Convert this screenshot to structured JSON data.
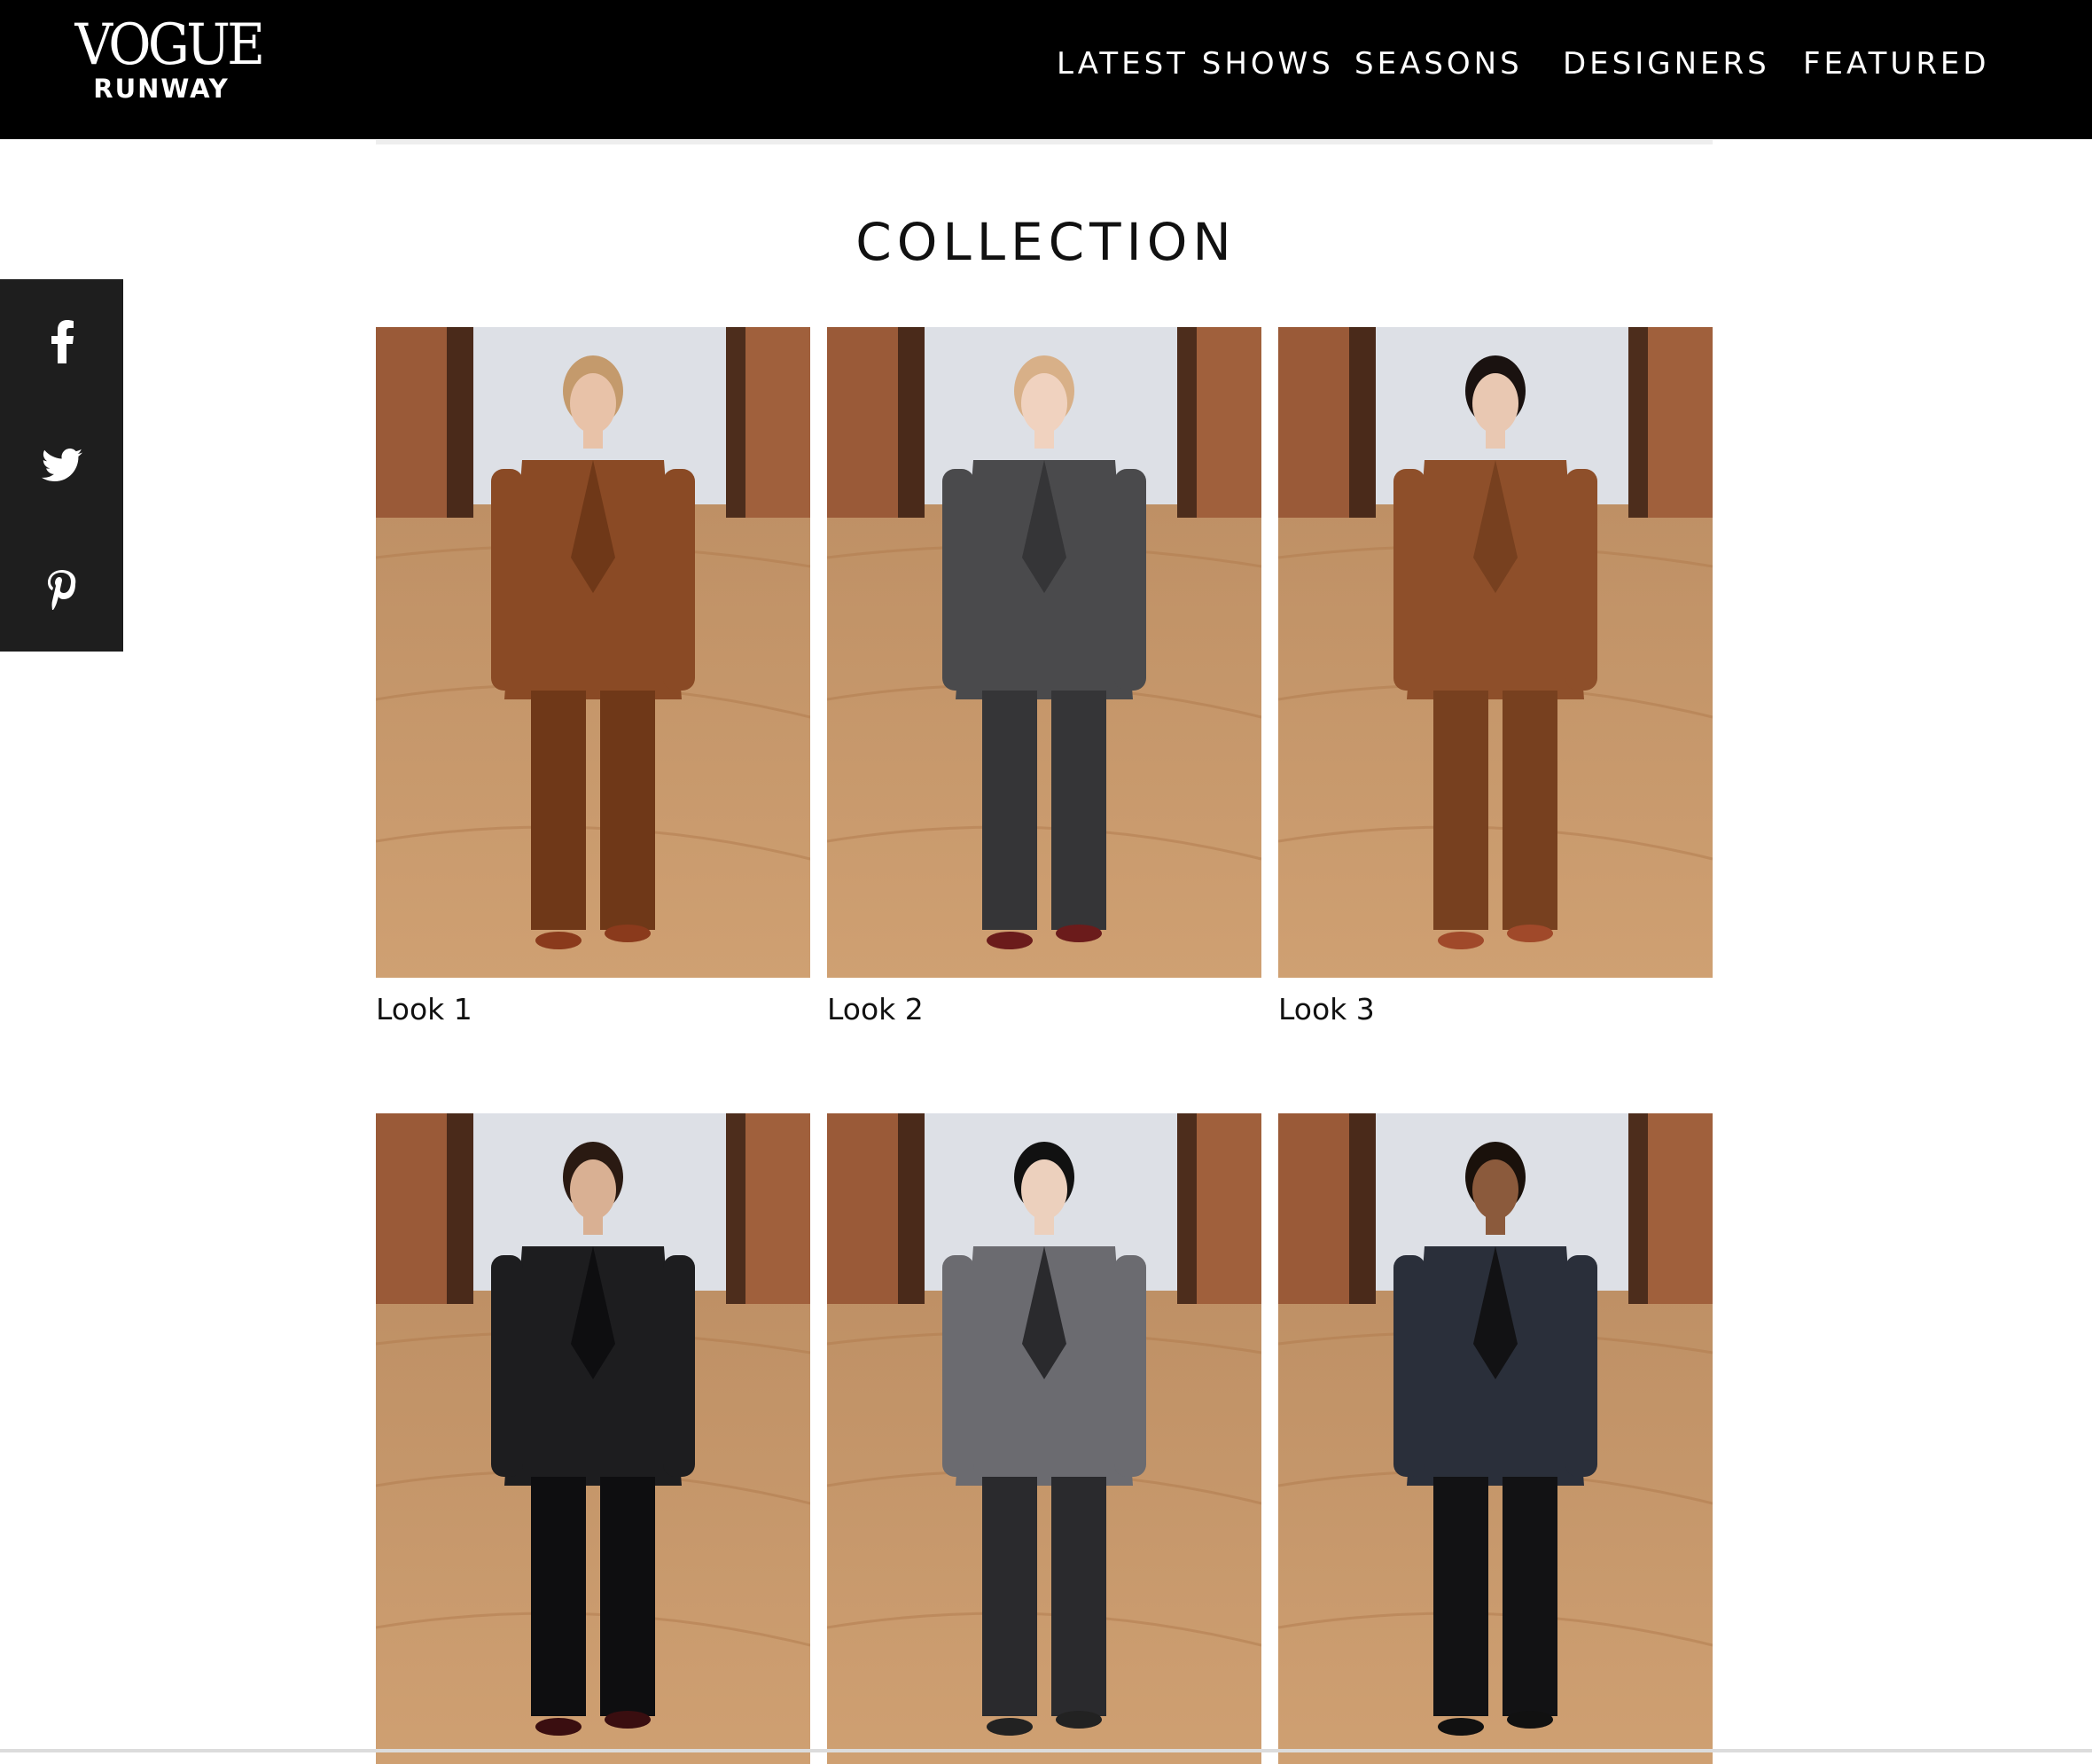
{
  "header": {
    "logo_main": "VOGUE",
    "logo_sub": "RUNWAY",
    "nav": [
      "LATEST SHOWS",
      "SEASONS",
      "DESIGNERS",
      "FEATURED"
    ]
  },
  "main": {
    "title": "COLLECTION",
    "looks": [
      {
        "label": "Look 1"
      },
      {
        "label": "Look 2"
      },
      {
        "label": "Look 3"
      },
      {
        "label": ""
      },
      {
        "label": ""
      },
      {
        "label": ""
      }
    ]
  },
  "share": {
    "icons": [
      "facebook-icon",
      "twitter-icon",
      "pinterest-icon"
    ]
  },
  "colors": {
    "header_bg": "#000000",
    "share_bg": "#1e1e1e",
    "runway_sand": "#c99a66",
    "backdrop": "#dde0e6",
    "barn_wood": "#9a5a38"
  }
}
